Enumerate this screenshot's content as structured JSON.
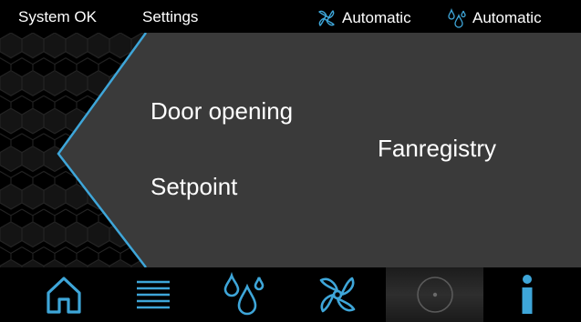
{
  "topbar": {
    "status": "System OK",
    "settings": "Settings",
    "fan_mode": "Automatic",
    "fan_icon": "fan-icon",
    "humidity_mode": "Automatic",
    "humidity_icon": "droplets-icon"
  },
  "main": {
    "items": [
      {
        "label": "Door opening"
      },
      {
        "label": "Setpoint"
      },
      {
        "label": "Fanregistry"
      }
    ]
  },
  "bottom_nav": [
    {
      "icon": "home-icon"
    },
    {
      "icon": "menu-icon"
    },
    {
      "icon": "droplets-icon"
    },
    {
      "icon": "fan-icon"
    },
    {
      "icon": "circle-icon"
    },
    {
      "icon": "info-icon"
    }
  ],
  "colors": {
    "accent_blue": "#3ea6d9",
    "panel_gray": "#3a3a3a",
    "background": "#000000"
  }
}
